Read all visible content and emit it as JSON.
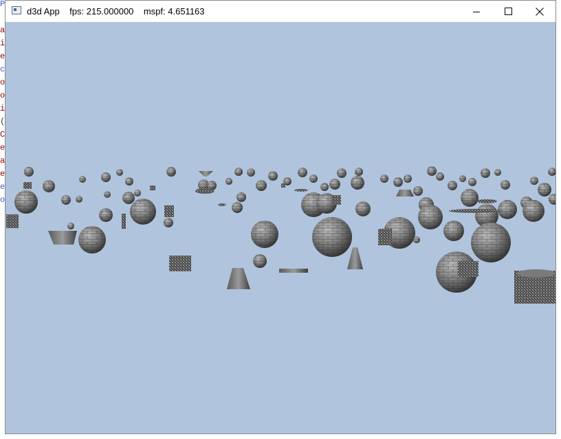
{
  "window": {
    "title": "d3d App    fps: 215.000000    mspf: 4.651163",
    "buttons": {
      "minimize": "minimize-icon",
      "maximize": "maximize-icon",
      "close": "close-icon"
    }
  },
  "background_chars": [
    "P",
    "a",
    "i",
    "e",
    "c",
    "o",
    "o",
    "i",
    "(",
    "C",
    "e",
    "a",
    "e",
    "e",
    "o"
  ],
  "colors": {
    "sky": "#b0c4de",
    "sphere_dark": "#3e3e3e",
    "sphere_light": "#8f8f8f",
    "text_dark_red": "#8b0000",
    "text_blue": "#3b5fc0"
  }
}
